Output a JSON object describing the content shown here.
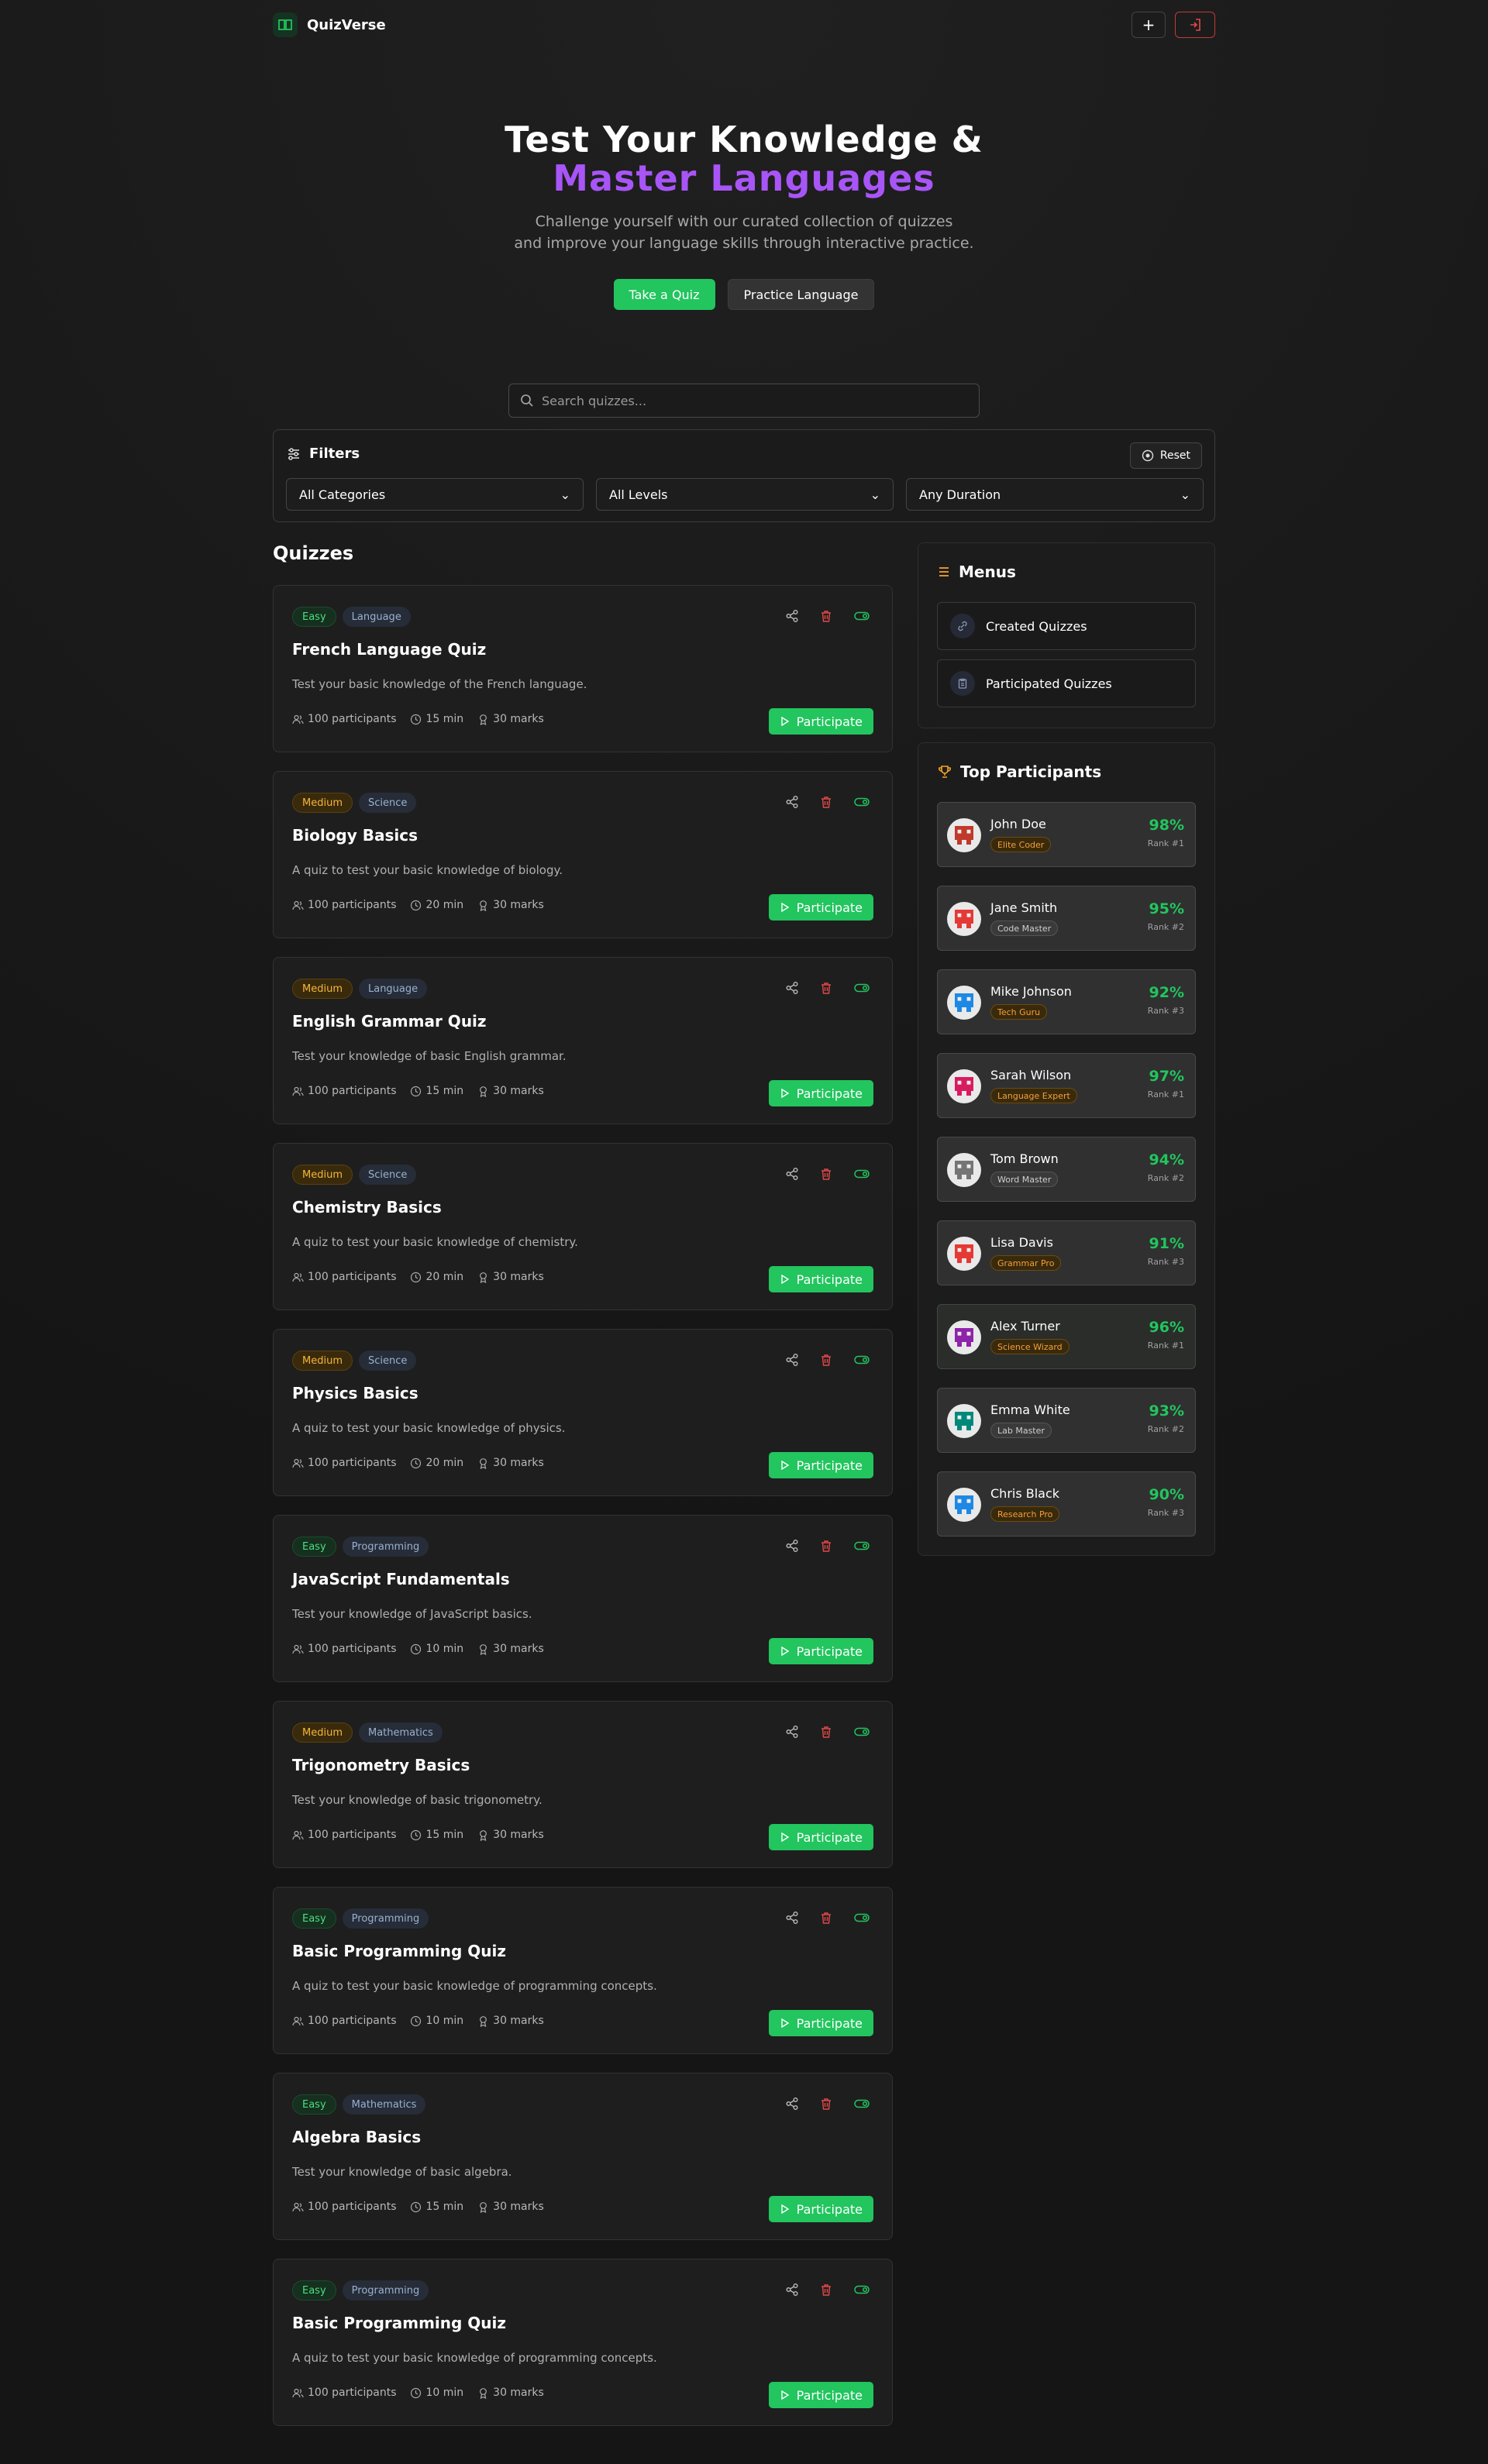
{
  "header": {
    "brand": "QuizVerse",
    "add_icon": "plus-icon",
    "login_icon": "login-icon"
  },
  "hero": {
    "title_line1": "Test Your Knowledge &",
    "title_line2": "Master Languages",
    "subtitle_line1": "Challenge yourself with our curated collection of quizzes",
    "subtitle_line2": "and improve your language skills through interactive practice.",
    "primary_button": "Take a Quiz",
    "secondary_button": "Practice Language"
  },
  "search": {
    "placeholder": "Search quizzes..."
  },
  "filters": {
    "title": "Filters",
    "reset": "Reset",
    "category": "All Categories",
    "level": "All Levels",
    "duration": "Any Duration"
  },
  "quizzes_title": "Quizzes",
  "quizzes": [
    {
      "level": "Easy",
      "category": "Language",
      "title": "French Language Quiz",
      "desc": "Test your basic knowledge of the French language.",
      "participants": "100 participants",
      "duration": "15 min",
      "marks": "30 marks"
    },
    {
      "level": "Medium",
      "category": "Science",
      "title": "Biology Basics",
      "desc": "A quiz to test your basic knowledge of biology.",
      "participants": "100 participants",
      "duration": "20 min",
      "marks": "30 marks"
    },
    {
      "level": "Medium",
      "category": "Language",
      "title": "English Grammar Quiz",
      "desc": "Test your knowledge of basic English grammar.",
      "participants": "100 participants",
      "duration": "15 min",
      "marks": "30 marks"
    },
    {
      "level": "Medium",
      "category": "Science",
      "title": "Chemistry Basics",
      "desc": "A quiz to test your basic knowledge of chemistry.",
      "participants": "100 participants",
      "duration": "20 min",
      "marks": "30 marks"
    },
    {
      "level": "Medium",
      "category": "Science",
      "title": "Physics Basics",
      "desc": "A quiz to test your basic knowledge of physics.",
      "participants": "100 participants",
      "duration": "20 min",
      "marks": "30 marks"
    },
    {
      "level": "Easy",
      "category": "Programming",
      "title": "JavaScript Fundamentals",
      "desc": "Test your knowledge of JavaScript basics.",
      "participants": "100 participants",
      "duration": "10 min",
      "marks": "30 marks"
    },
    {
      "level": "Medium",
      "category": "Mathematics",
      "title": "Trigonometry Basics",
      "desc": "Test your knowledge of basic trigonometry.",
      "participants": "100 participants",
      "duration": "15 min",
      "marks": "30 marks"
    },
    {
      "level": "Easy",
      "category": "Programming",
      "title": "Basic Programming Quiz",
      "desc": "A quiz to test your basic knowledge of programming concepts.",
      "participants": "100 participants",
      "duration": "10 min",
      "marks": "30 marks"
    },
    {
      "level": "Easy",
      "category": "Mathematics",
      "title": "Algebra Basics",
      "desc": "Test your knowledge of basic algebra.",
      "participants": "100 participants",
      "duration": "15 min",
      "marks": "30 marks"
    },
    {
      "level": "Easy",
      "category": "Programming",
      "title": "Basic Programming Quiz",
      "desc": "A quiz to test your basic knowledge of programming concepts.",
      "participants": "100 participants",
      "duration": "10 min",
      "marks": "30 marks"
    }
  ],
  "participate_label": "Participate",
  "menus": {
    "title": "Menus",
    "items": [
      "Created Quizzes",
      "Participated Quizzes"
    ]
  },
  "top": {
    "title": "Top Participants",
    "people": [
      {
        "name": "John Doe",
        "badge": "Elite Coder",
        "score": "98%",
        "rank": "Rank #1",
        "color": "#c0392b"
      },
      {
        "name": "Jane Smith",
        "badge": "Code Master",
        "score": "95%",
        "rank": "Rank #2",
        "color": "#e53935"
      },
      {
        "name": "Mike Johnson",
        "badge": "Tech Guru",
        "score": "92%",
        "rank": "Rank #3",
        "color": "#1e88e5"
      },
      {
        "name": "Sarah Wilson",
        "badge": "Language Expert",
        "score": "97%",
        "rank": "Rank #1",
        "color": "#d81b60"
      },
      {
        "name": "Tom Brown",
        "badge": "Word Master",
        "score": "94%",
        "rank": "Rank #2",
        "color": "#757575"
      },
      {
        "name": "Lisa Davis",
        "badge": "Grammar Pro",
        "score": "91%",
        "rank": "Rank #3",
        "color": "#e53935"
      },
      {
        "name": "Alex Turner",
        "badge": "Science Wizard",
        "score": "96%",
        "rank": "Rank #1",
        "color": "#8e24aa"
      },
      {
        "name": "Emma White",
        "badge": "Lab Master",
        "score": "93%",
        "rank": "Rank #2",
        "color": "#00897b"
      },
      {
        "name": "Chris Black",
        "badge": "Research Pro",
        "score": "90%",
        "rank": "Rank #3",
        "color": "#1e88e5"
      }
    ]
  }
}
